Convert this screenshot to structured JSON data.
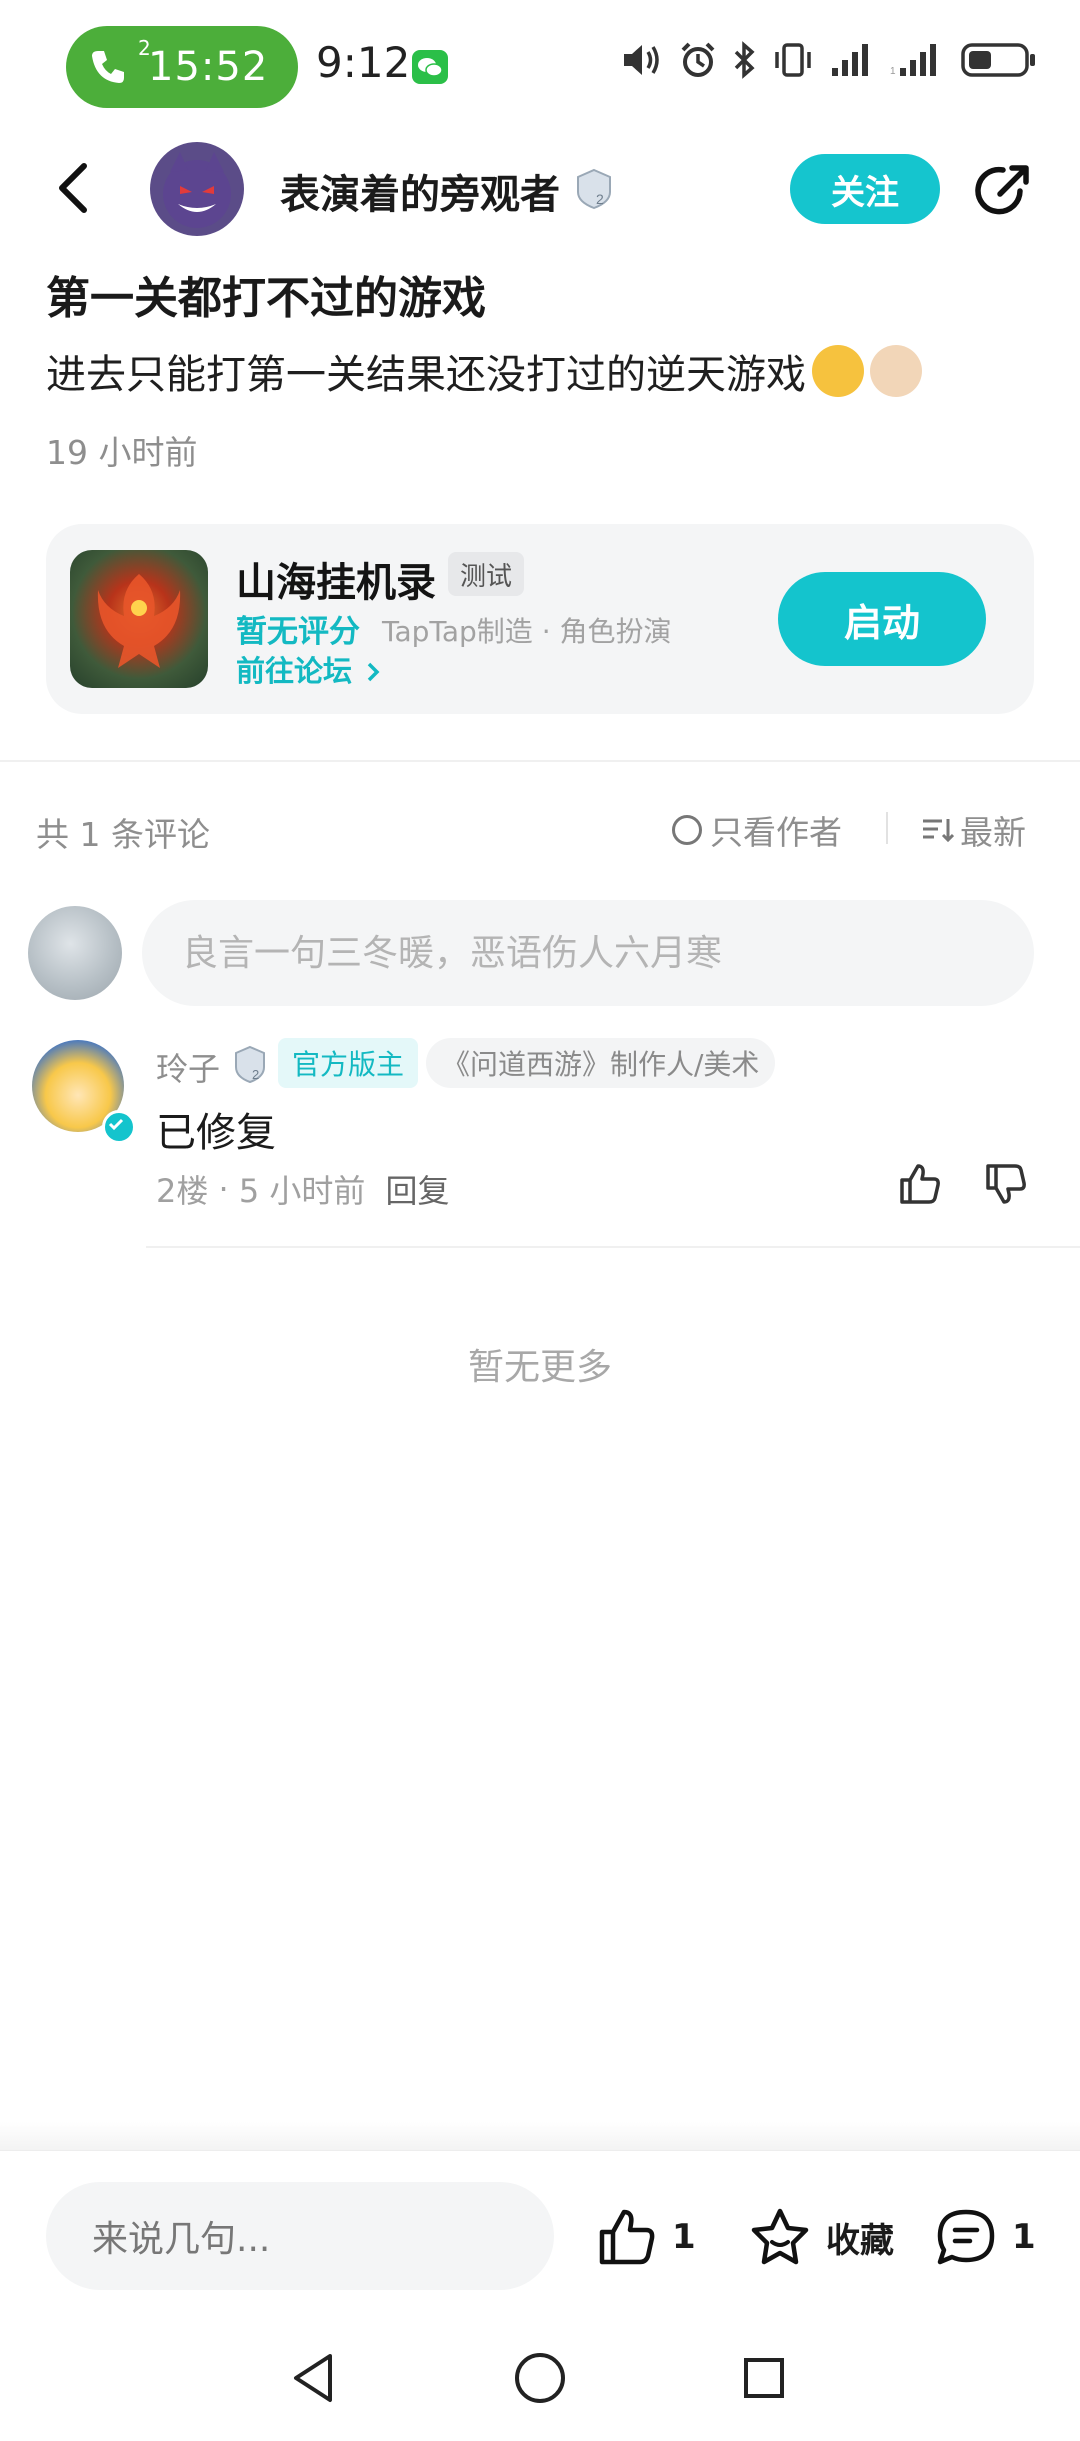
{
  "status_bar": {
    "call_timer": "15:52",
    "clock": "9:12",
    "call_badge": "2",
    "battery_level": 0.4,
    "icons": [
      "phone-icon",
      "wechat-icon",
      "volume-icon",
      "alarm-icon",
      "bluetooth-icon",
      "vibrate-icon",
      "signal-icon",
      "signal-icon",
      "battery-icon"
    ]
  },
  "header": {
    "username": "表演着的旁观者",
    "level": "2",
    "follow_label": "关注"
  },
  "post": {
    "title": "第一关都打不过的游戏",
    "body": "进去只能打第一关结果还没打过的逆天游戏",
    "time": "19 小时前"
  },
  "game_card": {
    "name": "山海挂机录",
    "tag": "测试",
    "rating": "暂无评分",
    "meta": "TapTap制造 · 角色扮演",
    "forum_link": "前往论坛",
    "launch_label": "启动"
  },
  "comments_header": {
    "count_text": "共 1 条评论",
    "only_author": "只看作者",
    "sort_label": "最新"
  },
  "comment_input": {
    "placeholder": "良言一句三冬暖，恶语伤人六月寒"
  },
  "comments": [
    {
      "name": "玲子",
      "level": "2",
      "tag_role": "官方版主",
      "tag_title": "《问道西游》制作人/美术",
      "text": "已修复",
      "floor": "2楼",
      "time": "5 小时前",
      "reply_label": "回复"
    }
  ],
  "no_more": "暂无更多",
  "bottom_bar": {
    "input_placeholder": "来说几句...",
    "like_count": "1",
    "favorite_label": "收藏",
    "comment_count": "1"
  },
  "colors": {
    "accent": "#14c4cd",
    "call_green": "#4cae3a"
  }
}
